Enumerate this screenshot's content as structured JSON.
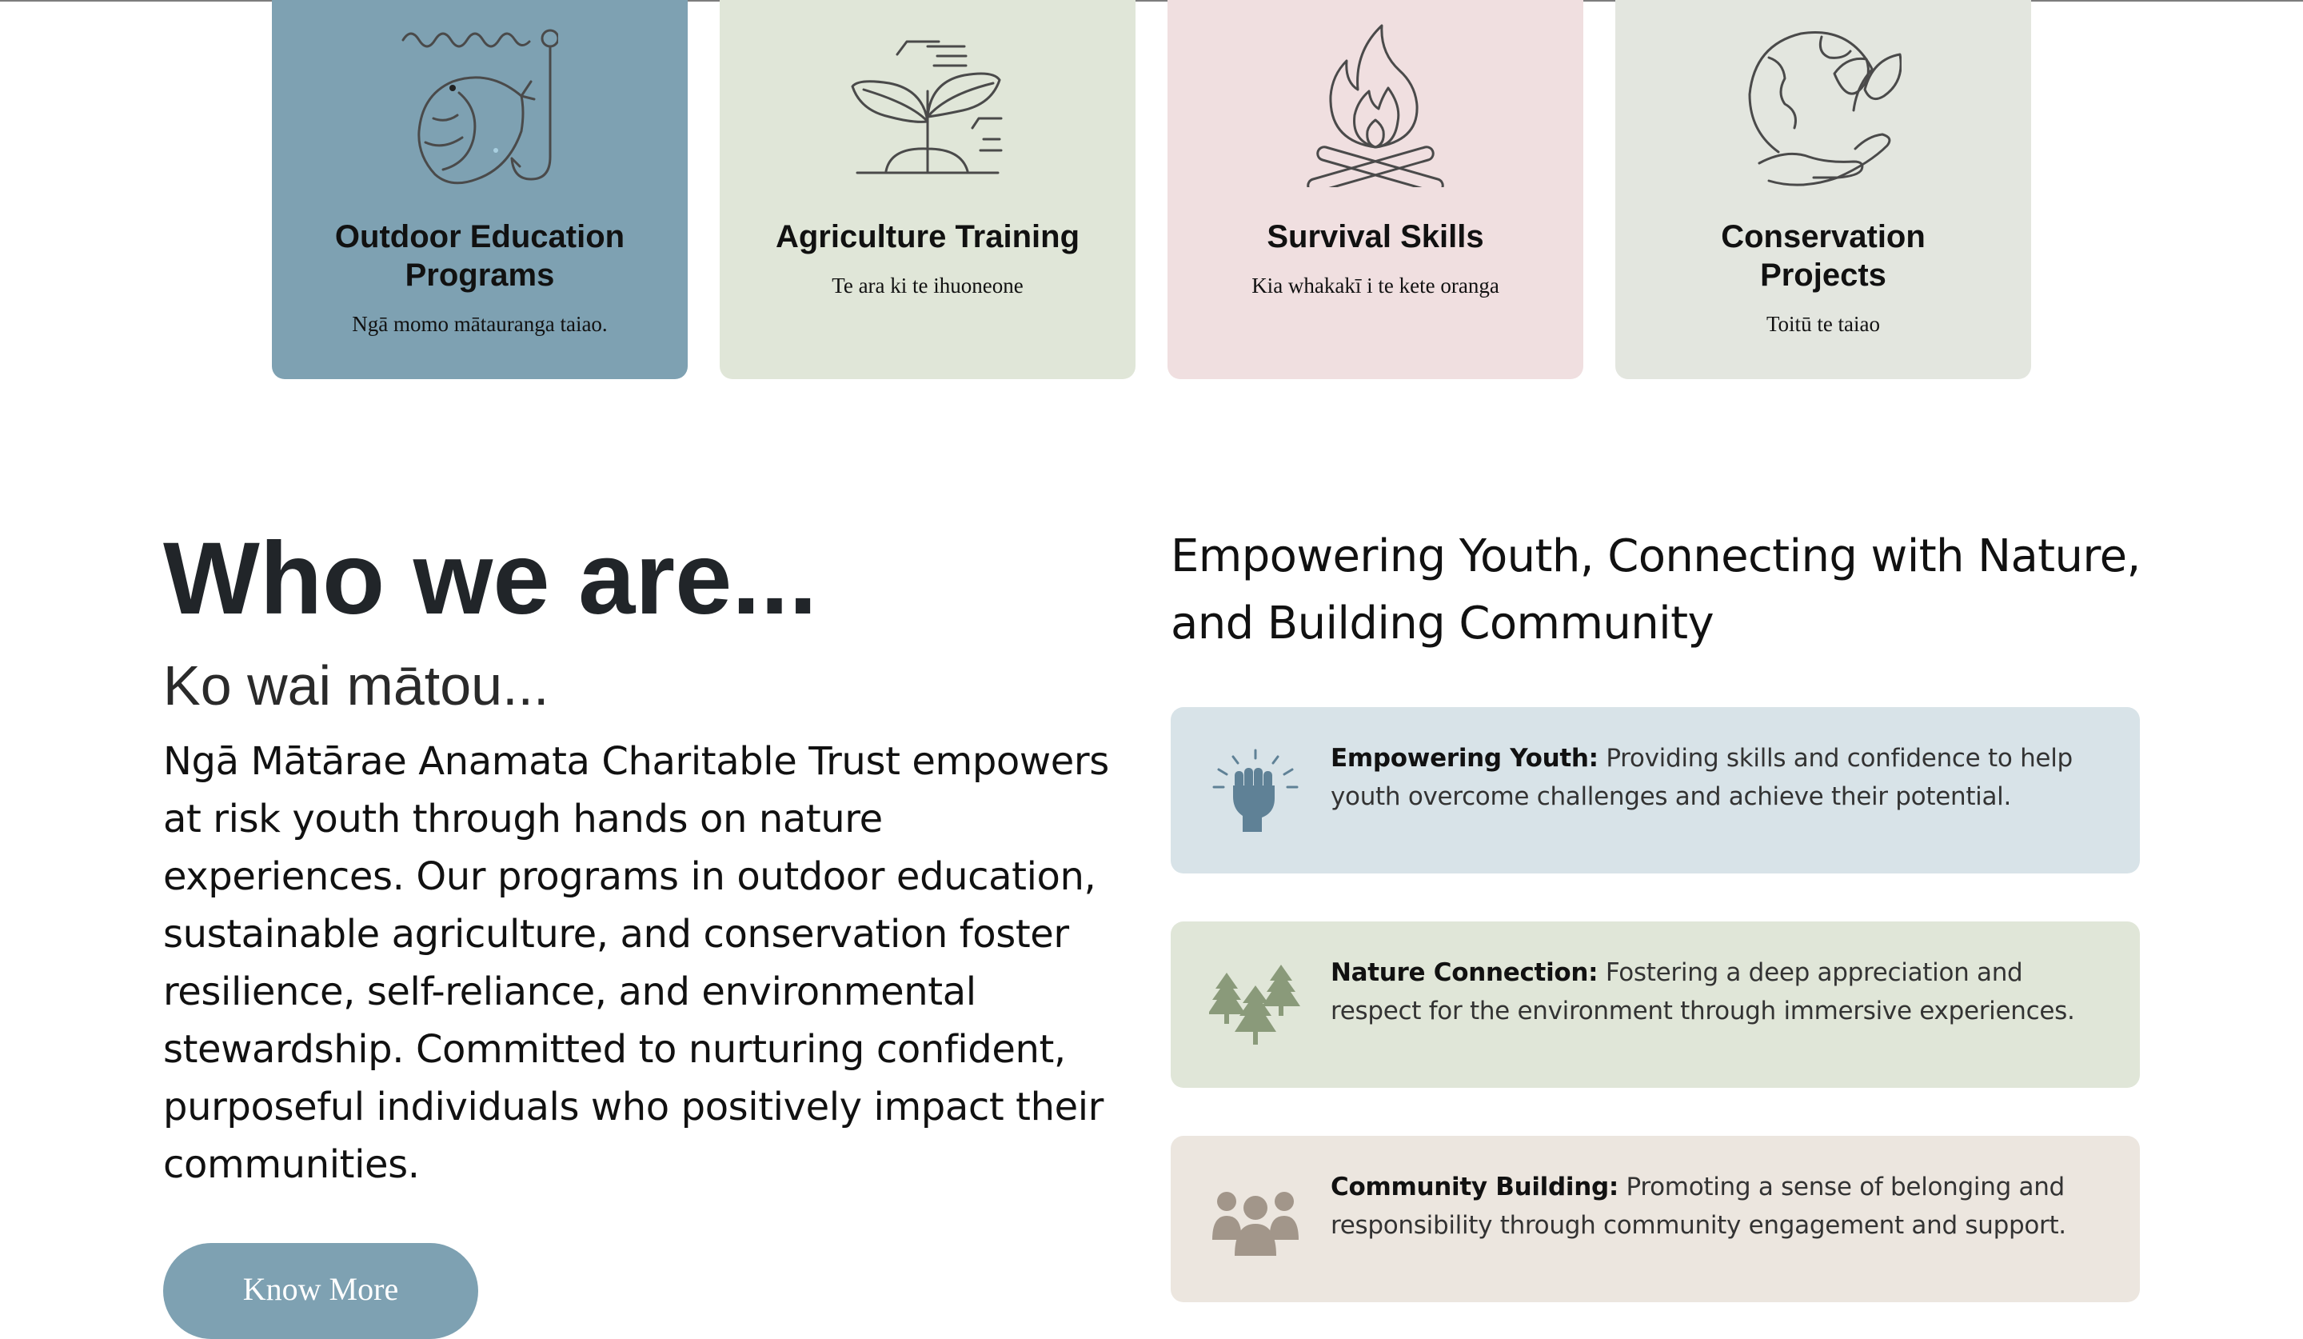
{
  "programs": [
    {
      "title_line1": "Outdoor Education",
      "title_line2": "Programs",
      "subtitle": "Ngā momo mātauranga taiao.",
      "icon": "fishing-hook-icon",
      "bg": "#7ea1b2"
    },
    {
      "title_line1": "Agriculture Training",
      "title_line2": "",
      "subtitle": "Te ara ki te ihuoneone",
      "icon": "seedling-icon",
      "bg": "#e0e6d8"
    },
    {
      "title_line1": "Survival Skills",
      "title_line2": "",
      "subtitle": "Kia whakakī i te kete oranga",
      "icon": "campfire-icon",
      "bg": "#f0dfe0"
    },
    {
      "title_line1": "Conservation",
      "title_line2": "Projects",
      "subtitle": "Toitū te taiao",
      "icon": "earth-hand-leaf-icon",
      "bg": "#e3e6df"
    }
  ],
  "about": {
    "title": "Who we are...",
    "subtitle": "Ko wai mātou...",
    "body": "Ngā Mātārae Anamata Charitable Trust empowers at risk youth through hands on nature experiences. Our programs in outdoor education, sustainable agriculture, and conservation foster resilience, self-reliance, and environmental stewardship. Committed to nurturing confident, purposeful individuals who positively impact their communities.",
    "button_label": "Know More"
  },
  "mission": {
    "heading": "Empowering Youth, Connecting with Nature, and Building Community"
  },
  "values": [
    {
      "label": "Empowering Youth:",
      "text": "Providing skills and confidence to help youth overcome challenges and achieve their potential.",
      "icon": "raised-fist-icon",
      "bg": "#d8e3e8",
      "icon_color": "#5f8196"
    },
    {
      "label": "Nature Connection:",
      "text": "Fostering a deep appreciation and respect for the environment through immersive experiences.",
      "icon": "pine-trees-icon",
      "bg": "#e0e6d8",
      "icon_color": "#8a9a7a"
    },
    {
      "label": "Community Building:",
      "text": "Promoting a sense of belonging and responsibility through community engagement and support.",
      "icon": "people-group-icon",
      "bg": "#ece6df",
      "icon_color": "#a2968a"
    }
  ],
  "colors": {
    "accent_blue": "#7ea1b2",
    "heading_text": "#212529"
  }
}
